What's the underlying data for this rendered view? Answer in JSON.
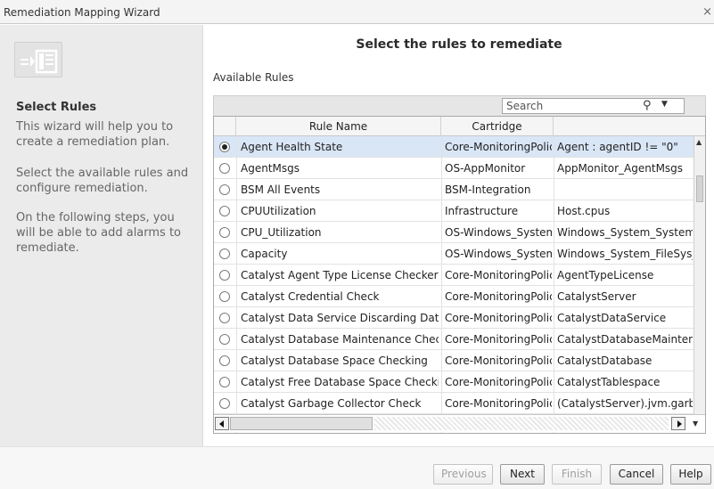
{
  "window": {
    "title": "Remediation Mapping Wizard",
    "close_glyph": "×"
  },
  "left": {
    "icon": "wizard-step-icon",
    "title": "Select Rules",
    "paragraphs": [
      "This wizard will help you to create a remediation plan.",
      "Select the available rules and configure remediation.",
      "On the following steps, you will be able to add alarms to remediate."
    ]
  },
  "main": {
    "heading": "Select the rules to remediate",
    "available_label": "Available Rules",
    "search": {
      "placeholder": "Search",
      "icon": "magnifier-icon"
    },
    "columns": [
      "",
      "Rule Name",
      "Cartridge",
      ""
    ],
    "rows": [
      {
        "name": "Agent Health State",
        "cartridge": "Core-MonitoringPolicy",
        "condition": "Agent : agentID != \"0\"",
        "selected": true
      },
      {
        "name": "AgentMsgs",
        "cartridge": "OS-AppMonitor",
        "condition": "AppMonitor_AgentMsgs",
        "selected": false
      },
      {
        "name": "BSM All Events",
        "cartridge": "BSM-Integration",
        "condition": "",
        "selected": false
      },
      {
        "name": "CPUUtilization",
        "cartridge": "Infrastructure",
        "condition": "Host.cpus",
        "selected": false
      },
      {
        "name": "CPU_Utilization",
        "cartridge": "OS-Windows_System",
        "condition": "Windows_System_System_",
        "selected": false
      },
      {
        "name": "Capacity",
        "cartridge": "OS-Windows_System",
        "condition": "Windows_System_FileSys_",
        "selected": false
      },
      {
        "name": "Catalyst Agent Type License Checker",
        "cartridge": "Core-MonitoringPolicy",
        "condition": "AgentTypeLicense",
        "selected": false
      },
      {
        "name": "Catalyst Credential Check",
        "cartridge": "Core-MonitoringPolicy",
        "condition": "CatalystServer",
        "selected": false
      },
      {
        "name": "Catalyst Data Service Discarding Data",
        "cartridge": "Core-MonitoringPolicy",
        "condition": "CatalystDataService",
        "selected": false
      },
      {
        "name": "Catalyst Database Maintenance Check",
        "cartridge": "Core-MonitoringPolicy",
        "condition": "CatalystDatabaseMaintena",
        "selected": false
      },
      {
        "name": "Catalyst Database Space Checking",
        "cartridge": "Core-MonitoringPolicy",
        "condition": "CatalystDatabase",
        "selected": false
      },
      {
        "name": "Catalyst Free Database Space Checking",
        "cartridge": "Core-MonitoringPolicy",
        "condition": "CatalystTablespace",
        "selected": false
      },
      {
        "name": "Catalyst Garbage Collector Check",
        "cartridge": "Core-MonitoringPolicy",
        "condition": "(CatalystServer).jvm.garba",
        "selected": false
      }
    ]
  },
  "footer": {
    "buttons": [
      {
        "label": "Previous",
        "enabled": false
      },
      {
        "label": "Next",
        "enabled": true
      },
      {
        "label": "Finish",
        "enabled": false
      },
      {
        "label": "Cancel",
        "enabled": true
      },
      {
        "label": "Help",
        "enabled": true
      }
    ]
  }
}
